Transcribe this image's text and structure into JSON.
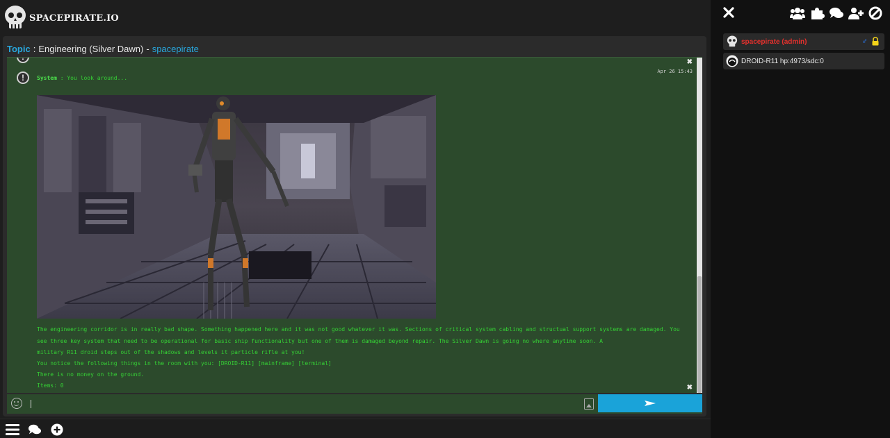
{
  "header": {
    "brand": "SPACEPIRATE.IO",
    "logo_icon": "skull-icon"
  },
  "topic": {
    "label": "Topic",
    "separator": ":",
    "name": "Engineering (Silver Dawn)",
    "dash": "-",
    "owner": "spacepirate"
  },
  "messages": {
    "system_sender": "System",
    "system_text": ": You look around...",
    "timestamp": "Apr 26 15:43",
    "lines": [
      "The engineering corridor is in really bad shape. Something happened here and it was not good whatever it was. Sections of critical system cabling and structual support systems are damaged. You",
      "see three key system that need to be operational for basic ship functionality but one of them is damaged beyond repair. The Silver Dawn is going no where anytime soon. A",
      "military R11 droid steps out of the shadows and levels it particle rifle at you!",
      "You notice the following things in the room with you: [DROID-R11] [mainframe] [terminal]",
      "There is no money on the ground.",
      "Items: 0"
    ]
  },
  "composer": {
    "placeholder": "",
    "value": ""
  },
  "sidebar": {
    "users": [
      {
        "name": "spacepirate (admin)",
        "gender": "♂"
      },
      {
        "name": "DROID-R11 hp:4973/sdc:0"
      }
    ]
  },
  "colors": {
    "accent": "#1aa3d9",
    "chat_bg": "#2c4a2c",
    "chat_text": "#35d035",
    "admin_name": "#e8312d"
  }
}
